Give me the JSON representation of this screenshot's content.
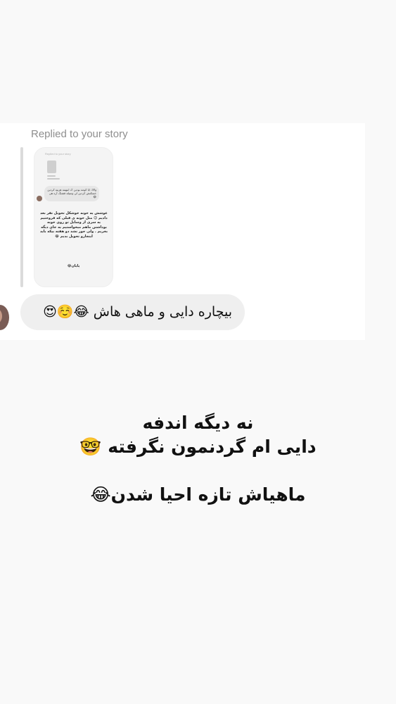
{
  "reply": {
    "label": "Replied to your story"
  },
  "story_preview": {
    "caption": "Replied to your story",
    "bubble_text": "والاا. ایا کومه بودین ک اینهمه هزینه کردین خسکنش کردین لن وسیله قشنگ آره هی 😂",
    "body_text": "عوشش یه خونه خوشکل تحویل نفر بعد دادیم 😉 مثل خونه ی قبلی که فروختیم یه سری از وسایل تو روی خونه بوداشتن ماهم میخواستیم یه جای دیگه بخریم . ولی جور نشد دو هفته بیکه باید اینجارو تحویل بدیم 😂",
    "end_text": "پایان😂"
  },
  "message": {
    "text": "بیچاره دایی و ماهی هاش 😂☺️😍"
  },
  "overlay": {
    "line1": "نه دیگه اندفه",
    "line2": "دایی ام گردنمون نگرفته 🤓",
    "line3": "ماهیاش تازه احیا شدن😂"
  }
}
